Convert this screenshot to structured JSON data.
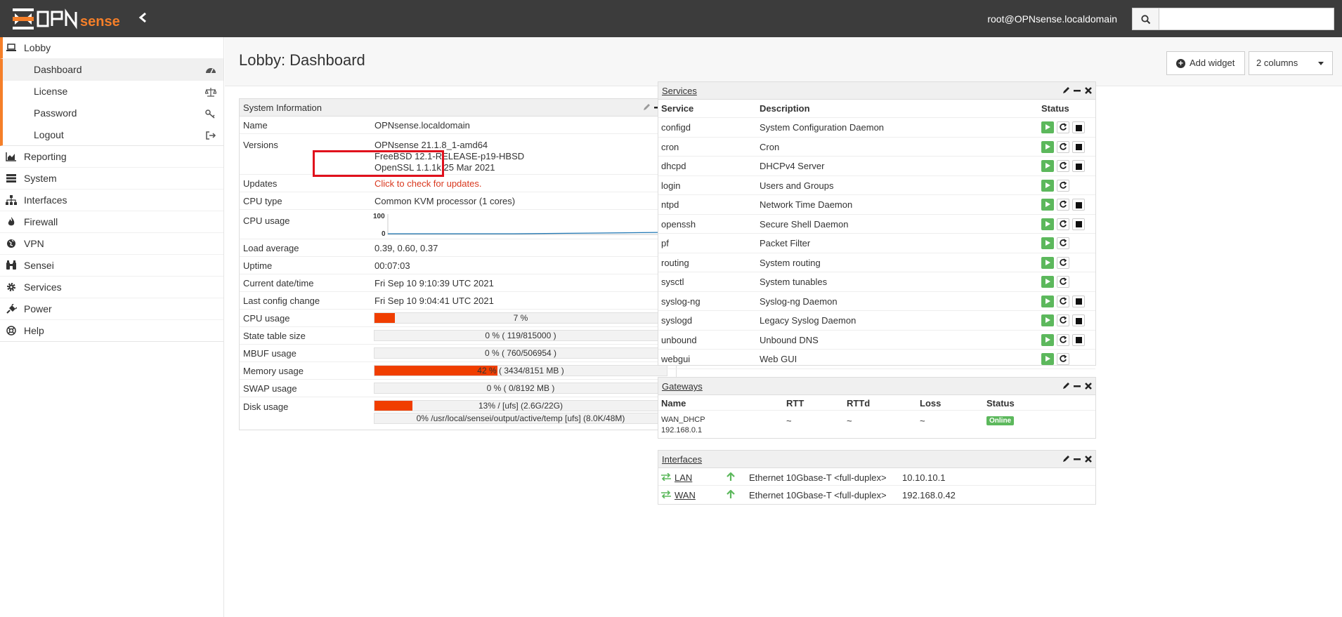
{
  "header": {
    "user": "root@OPNsense.localdomain",
    "search_placeholder": ""
  },
  "sidebar": {
    "lobby": "Lobby",
    "lobby_items": [
      "Dashboard",
      "License",
      "Password",
      "Logout"
    ],
    "items": [
      "Reporting",
      "System",
      "Interfaces",
      "Firewall",
      "VPN",
      "Sensei",
      "Services",
      "Power",
      "Help"
    ]
  },
  "page": {
    "title": "Lobby: Dashboard",
    "add_widget": "Add widget",
    "columns": "2 columns"
  },
  "system_info": {
    "title": "System Information",
    "name_label": "Name",
    "name": "OPNsense.localdomain",
    "versions_label": "Versions",
    "versions": [
      "OPNsense 21.1.8_1-amd64",
      "FreeBSD 12.1-RELEASE-p19-HBSD",
      "OpenSSL 1.1.1k 25 Mar 2021"
    ],
    "updates_label": "Updates",
    "updates_link": "Click to check for updates.",
    "cpu_type_label": "CPU type",
    "cpu_type": "Common KVM processor (1 cores)",
    "cpu_usage_label": "CPU usage",
    "cpu_graph_max": "100",
    "cpu_graph_min": "0",
    "load_label": "Load average",
    "load": "0.39, 0.60, 0.37",
    "uptime_label": "Uptime",
    "uptime": "00:07:03",
    "datetime_label": "Current date/time",
    "datetime": "Fri Sep 10 9:10:39 UTC 2021",
    "lastconfig_label": "Last config change",
    "lastconfig": "Fri Sep 10 9:04:41 UTC 2021",
    "cpu_bar_label": "CPU usage",
    "cpu_bar_text": "7 %",
    "cpu_bar_pct": 7,
    "state_label": "State table size",
    "state_text": "0 % ( 119/815000 )",
    "state_pct": 0,
    "mbuf_label": "MBUF usage",
    "mbuf_text": "0 % ( 760/506954 )",
    "mbuf_pct": 0,
    "mem_label": "Memory usage",
    "mem_text": "42 % ( 3434/8151 MB )",
    "mem_pct": 42,
    "swap_label": "SWAP usage",
    "swap_text": "0 % ( 0/8192 MB )",
    "swap_pct": 0,
    "disk_label": "Disk usage",
    "disk_text": "13% / [ufs] (2.6G/22G)",
    "disk_pct": 13,
    "disk2_text": "0% /usr/local/sensei/output/active/temp [ufs] (8.0K/48M)",
    "disk2_pct": 0
  },
  "services": {
    "title": "Services",
    "headers": [
      "Service",
      "Description",
      "Status"
    ],
    "rows": [
      {
        "name": "configd",
        "desc": "System Configuration Daemon",
        "stop": true
      },
      {
        "name": "cron",
        "desc": "Cron",
        "stop": true
      },
      {
        "name": "dhcpd",
        "desc": "DHCPv4 Server",
        "stop": true
      },
      {
        "name": "login",
        "desc": "Users and Groups",
        "stop": false
      },
      {
        "name": "ntpd",
        "desc": "Network Time Daemon",
        "stop": true
      },
      {
        "name": "openssh",
        "desc": "Secure Shell Daemon",
        "stop": true
      },
      {
        "name": "pf",
        "desc": "Packet Filter",
        "stop": false
      },
      {
        "name": "routing",
        "desc": "System routing",
        "stop": false
      },
      {
        "name": "sysctl",
        "desc": "System tunables",
        "stop": false
      },
      {
        "name": "syslog-ng",
        "desc": "Syslog-ng Daemon",
        "stop": true
      },
      {
        "name": "syslogd",
        "desc": "Legacy Syslog Daemon",
        "stop": true
      },
      {
        "name": "unbound",
        "desc": "Unbound DNS",
        "stop": true
      },
      {
        "name": "webgui",
        "desc": "Web GUI",
        "stop": false
      }
    ]
  },
  "gateways": {
    "title": "Gateways",
    "headers": [
      "Name",
      "RTT",
      "RTTd",
      "Loss",
      "Status"
    ],
    "rows": [
      {
        "name": "WAN_DHCP",
        "ip": "192.168.0.1",
        "rtt": "~",
        "rttd": "~",
        "loss": "~",
        "status": "Online"
      }
    ]
  },
  "interfaces": {
    "title": "Interfaces",
    "rows": [
      {
        "name": "LAN",
        "media": "Ethernet 10Gbase-T <full-duplex>",
        "ip": "10.10.10.1"
      },
      {
        "name": "WAN",
        "media": "Ethernet 10Gbase-T <full-duplex>",
        "ip": "192.168.0.42"
      }
    ]
  },
  "colors": {
    "accent": "#f57f29",
    "bar_fill": "#f03e00",
    "topbar": "#3c3c3c",
    "success": "#5cb85c"
  }
}
